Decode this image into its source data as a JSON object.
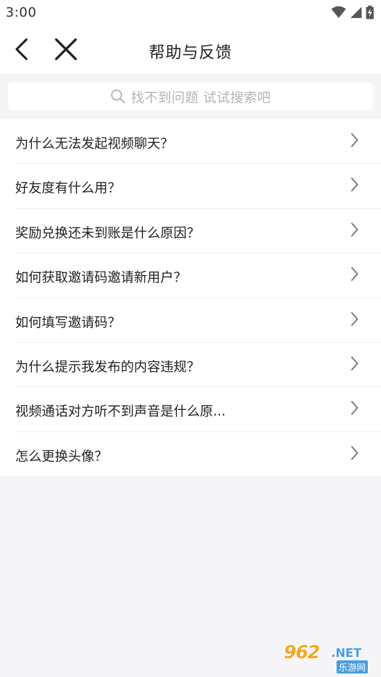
{
  "status_bar": {
    "time": "3:00",
    "icons": [
      "wifi-icon",
      "signal-icon",
      "battery-charging-icon"
    ]
  },
  "nav": {
    "title": "帮助与反馈",
    "back_icon": "chevron-left-icon",
    "close_icon": "close-icon"
  },
  "search": {
    "placeholder": "找不到问题 试试搜索吧",
    "icon": "search-icon"
  },
  "faq": {
    "items": [
      {
        "label": "为什么无法发起视频聊天？"
      },
      {
        "label": "好友度有什么用？"
      },
      {
        "label": "奖励兑换还未到账是什么原因？"
      },
      {
        "label": "如何获取邀请码邀请新用户？"
      },
      {
        "label": "如何填写邀请码？"
      },
      {
        "label": "为什么提示我发布的内容违规？"
      },
      {
        "label": "视频通话对方听不到声音是什么原..."
      },
      {
        "label": "怎么更换头像？"
      }
    ],
    "chevron_icon": "chevron-right-icon"
  },
  "watermark": {
    "main": "962",
    "net": ".NET",
    "sub": "乐游网"
  },
  "colors": {
    "background": "#f5f5f7",
    "surface": "#ffffff",
    "text_primary": "#222222",
    "placeholder": "#b4b4b8",
    "divider": "#ececee",
    "watermark_orange": "#f4a623",
    "watermark_blue": "#4a9de0"
  }
}
